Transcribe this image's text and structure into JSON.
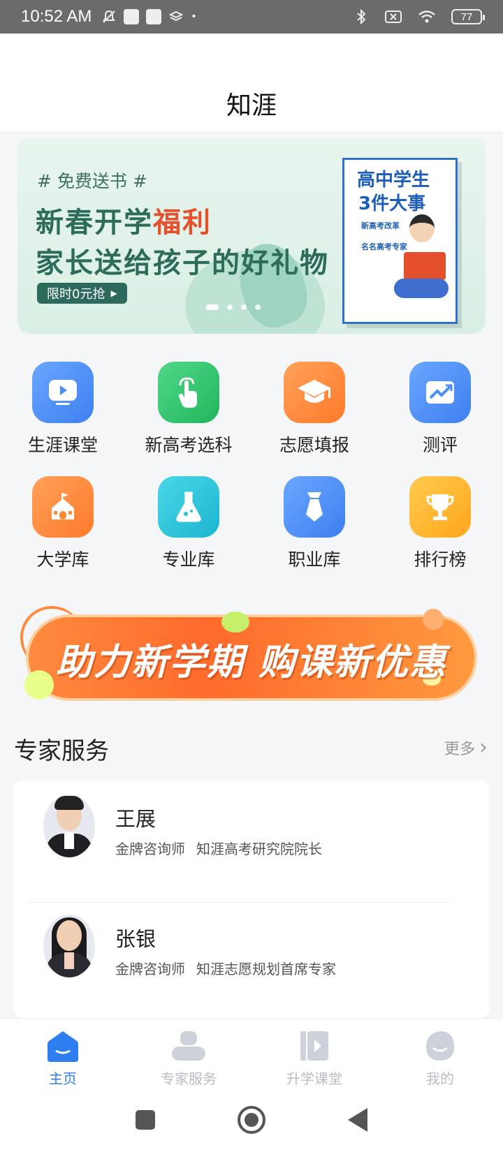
{
  "status_bar": {
    "time": "10:52 AM",
    "battery": "77",
    "icons": [
      "mute-icon",
      "notification-square-icon",
      "notification-square-icon",
      "layers-icon",
      "dot-icon",
      "bluetooth-icon",
      "no-sim-icon",
      "wifi-icon",
      "battery-icon"
    ]
  },
  "header": {
    "title": "知涯"
  },
  "banner": {
    "tag": "# 免费送书 #",
    "line1_prefix": "新春开学",
    "line1_highlight": "福利",
    "line2": "家长送给孩子的好礼物",
    "cta": "限时0元抢",
    "book_title_1": "高中学生",
    "book_title_2": "3件大事",
    "book_sub_1": "新高考改革",
    "book_sub_2": "名名高考专家",
    "slide_count": 4,
    "active_slide": 0
  },
  "grid": {
    "items": [
      {
        "label": "生涯课堂",
        "icon": "play-screen-icon",
        "color": "#4a8ff5"
      },
      {
        "label": "新高考选科",
        "icon": "tap-hand-icon",
        "color": "#2ec36a"
      },
      {
        "label": "志愿填报",
        "icon": "graduation-cap-icon",
        "color": "#ff8a35"
      },
      {
        "label": "测评",
        "icon": "trend-chart-icon",
        "color": "#4a8ff5"
      },
      {
        "label": "大学库",
        "icon": "school-building-icon",
        "color": "#ff8a35"
      },
      {
        "label": "专业库",
        "icon": "flask-icon",
        "color": "#25c2d6"
      },
      {
        "label": "职业库",
        "icon": "tie-icon",
        "color": "#4a8ff5"
      },
      {
        "label": "排行榜",
        "icon": "trophy-icon",
        "color": "#ffb425"
      }
    ]
  },
  "promo": {
    "text": "助力新学期 购课新优惠"
  },
  "experts_section": {
    "title": "专家服务",
    "more": "更多",
    "experts": [
      {
        "name": "王展",
        "level": "金牌咨询师",
        "title": "知涯高考研究院院长"
      },
      {
        "name": "张银",
        "level": "金牌咨询师",
        "title": "知涯志愿规划首席专家"
      }
    ]
  },
  "bottom_nav": {
    "items": [
      {
        "label": "主页",
        "active": true
      },
      {
        "label": "专家服务",
        "active": false
      },
      {
        "label": "升学课堂",
        "active": false
      },
      {
        "label": "我的",
        "active": false
      }
    ]
  },
  "colors": {
    "accent": "#2f7ef0",
    "inactive": "#b8bcc4"
  }
}
